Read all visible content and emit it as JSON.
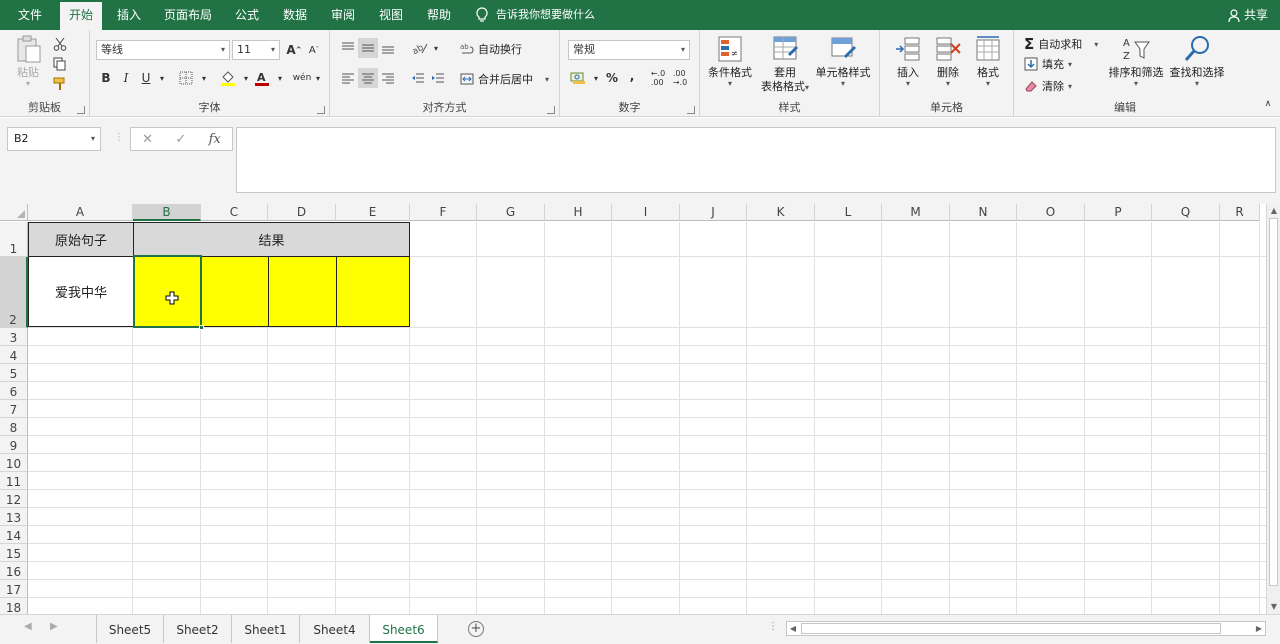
{
  "tabs": [
    {
      "label": "文件",
      "active": false
    },
    {
      "label": "开始",
      "active": true
    },
    {
      "label": "插入",
      "active": false
    },
    {
      "label": "页面布局",
      "active": false
    },
    {
      "label": "公式",
      "active": false
    },
    {
      "label": "数据",
      "active": false
    },
    {
      "label": "审阅",
      "active": false
    },
    {
      "label": "视图",
      "active": false
    },
    {
      "label": "帮助",
      "active": false
    }
  ],
  "tell_me": "告诉我你想要做什么",
  "share_label": "共享",
  "ribbon": {
    "clipboard": {
      "paste": "粘贴",
      "label": "剪贴板"
    },
    "font": {
      "name": "等线",
      "size": "11",
      "bold": "B",
      "italic": "I",
      "underline": "U",
      "label": "字体"
    },
    "alignment": {
      "wrap": "自动换行",
      "merge": "合并后居中",
      "label": "对齐方式"
    },
    "number": {
      "format": "常规",
      "percent": "%",
      "comma": ",",
      "label": "数字"
    },
    "styles": {
      "conditional": "条件格式",
      "table_format_1": "套用",
      "table_format_2": "表格格式",
      "cell_styles": "单元格样式",
      "label": "样式"
    },
    "cells": {
      "insert": "插入",
      "delete": "删除",
      "format": "格式",
      "label": "单元格"
    },
    "editing": {
      "autosum": "自动求和",
      "fill": "填充",
      "clear": "清除",
      "sort_filter": "排序和筛选",
      "find_select": "查找和选择",
      "label": "编辑"
    }
  },
  "formula_bar": {
    "name_box": "B2",
    "fx": "fx",
    "formula": ""
  },
  "columns": [
    "A",
    "B",
    "C",
    "D",
    "E",
    "F",
    "G",
    "H",
    "I",
    "J",
    "K",
    "L",
    "M",
    "N",
    "O",
    "P",
    "Q",
    "R"
  ],
  "selected_column": "B",
  "rows": [
    "1",
    "2",
    "3",
    "4",
    "5",
    "6",
    "7",
    "8",
    "9",
    "10",
    "11",
    "12",
    "13",
    "14",
    "15",
    "16",
    "17",
    "18"
  ],
  "selected_row": "2",
  "cells": {
    "A1": "原始句子",
    "B1": "结果",
    "A2": "爱我中华"
  },
  "colors": {
    "accent": "#217346",
    "header_fill": "#d9d9d9",
    "highlight_fill": "#ffff00"
  },
  "sheets": [
    {
      "label": "Sheet5",
      "active": false
    },
    {
      "label": "Sheet2",
      "active": false
    },
    {
      "label": "Sheet1",
      "active": false
    },
    {
      "label": "Sheet4",
      "active": false
    },
    {
      "label": "Sheet6",
      "active": true
    }
  ]
}
